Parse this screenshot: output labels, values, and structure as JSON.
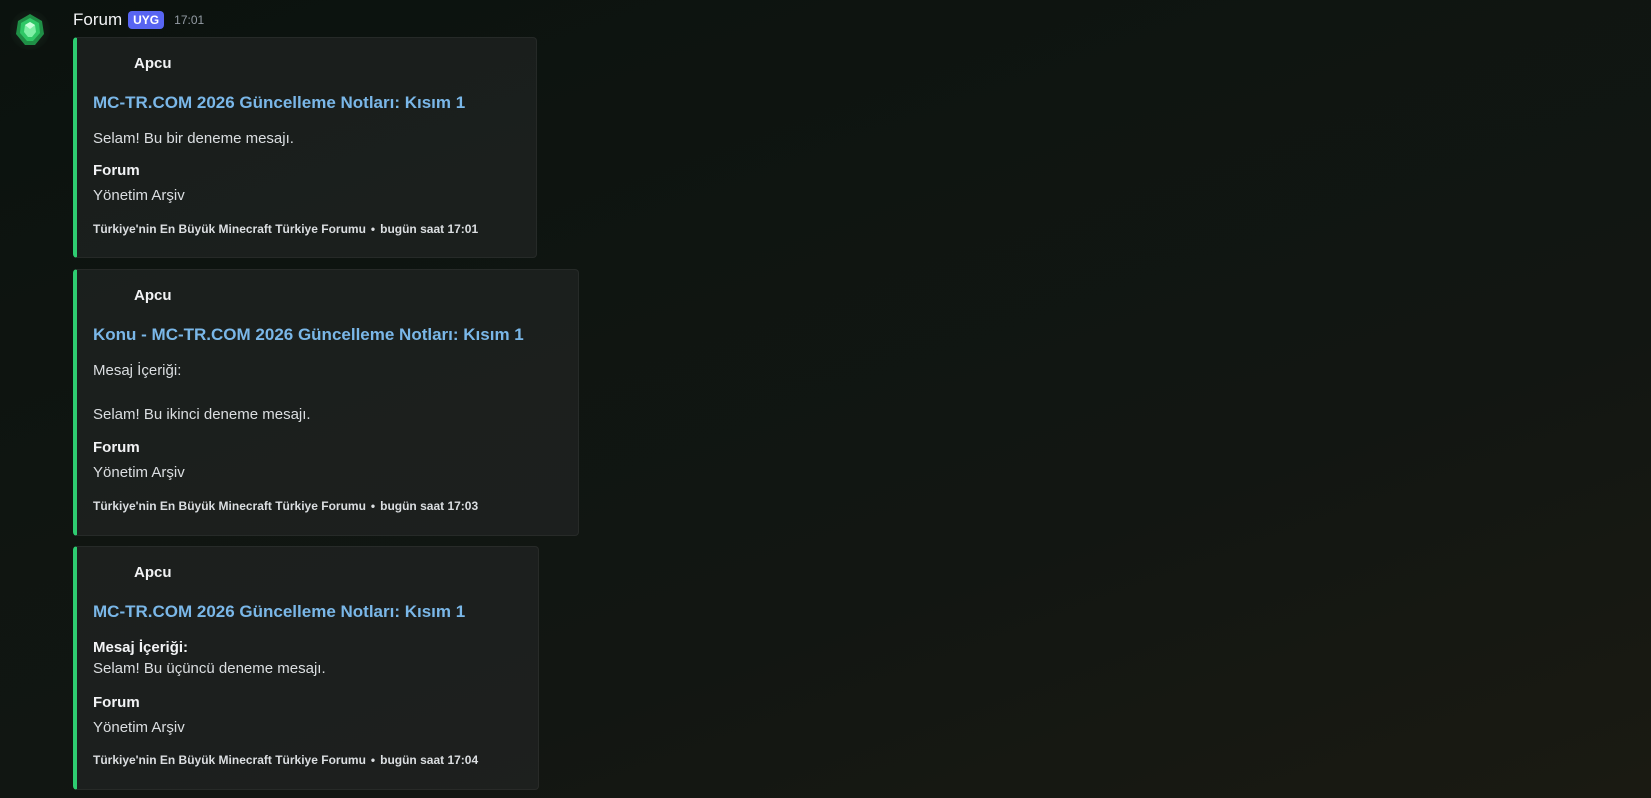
{
  "message": {
    "author": "Forum",
    "badge": "UYG",
    "time": "17:01",
    "avatar_icon": "emerald-gem-icon"
  },
  "embeds": [
    {
      "author": "Apcu",
      "title": "MC-TR.COM 2026 Güncelleme Notları: Kısım 1",
      "description": "Selam! Bu bir deneme mesajı.",
      "field_name": "Forum",
      "field_value": "Yönetim Arşiv",
      "footer_text": "Türkiye'nin En Büyük Minecraft Türkiye Forumu",
      "footer_separator": "•",
      "footer_time": "bugün saat 17:01"
    },
    {
      "author": "Apcu",
      "title": "Konu - MC-TR.COM 2026 Güncelleme Notları: Kısım 1",
      "description_line1": "Mesaj İçeriği:",
      "description_line2": "Selam! Bu ikinci deneme mesajı.",
      "field_name": "Forum",
      "field_value": "Yönetim Arşiv",
      "footer_text": "Türkiye'nin En Büyük Minecraft Türkiye Forumu",
      "footer_separator": "•",
      "footer_time": "bugün saat 17:03"
    },
    {
      "author": "Apcu",
      "title": "MC-TR.COM 2026 Güncelleme Notları: Kısım 1",
      "description_bold": "Mesaj İçeriği:",
      "description_line2": "Selam! Bu üçüncü deneme mesajı.",
      "field_name": "Forum",
      "field_value": "Yönetim Arşiv",
      "footer_text": "Türkiye'nin En Büyük Minecraft Türkiye Forumu",
      "footer_separator": "•",
      "footer_time": "bugün saat 17:04"
    }
  ],
  "colors": {
    "embed_accent": "#2ecc71",
    "title_link": "#7ab7e8",
    "badge_bg": "#5865f2"
  }
}
